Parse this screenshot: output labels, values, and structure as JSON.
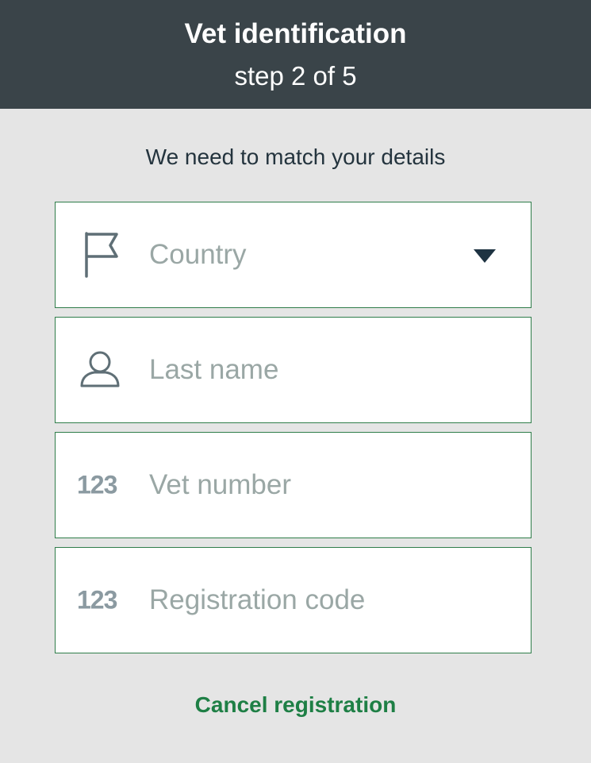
{
  "header": {
    "title": "Vet identification",
    "step": "step 2 of 5"
  },
  "subtitle": "We need to match your details",
  "form": {
    "country": {
      "placeholder": "Country",
      "icon": "flag-icon"
    },
    "last_name": {
      "placeholder": "Last name",
      "icon": "person-icon"
    },
    "vet_number": {
      "placeholder": "Vet number",
      "icon_text": "123"
    },
    "registration_code": {
      "placeholder": "Registration code",
      "icon_text": "123"
    }
  },
  "cancel_label": "Cancel registration",
  "colors": {
    "header_bg": "#3a4449",
    "page_bg": "#e5e5e5",
    "field_border": "#2f7d4a",
    "accent_green": "#1e7f45",
    "placeholder": "#9aa7a5"
  }
}
